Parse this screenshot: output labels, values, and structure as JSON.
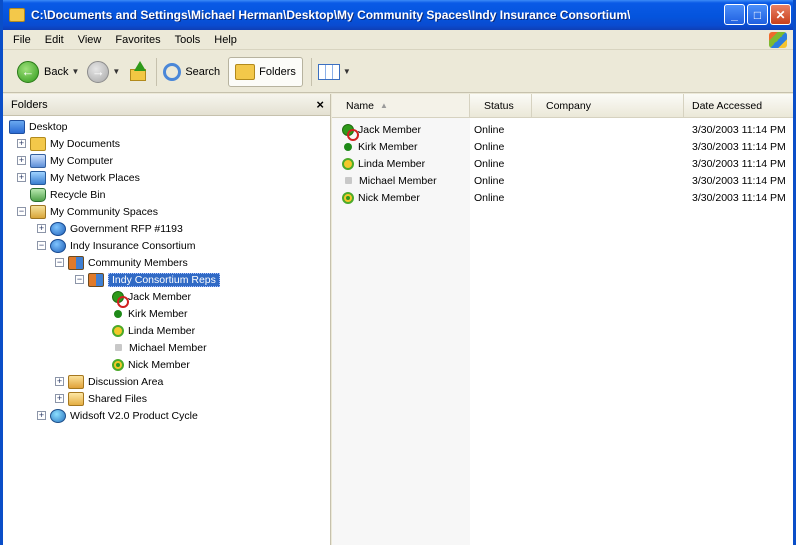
{
  "window": {
    "title": "C:\\Documents and Settings\\Michael Herman\\Desktop\\My Community Spaces\\Indy Insurance Consortium\\",
    "minimize": "_",
    "maximize": "□",
    "close": "✕"
  },
  "menu": [
    "File",
    "Edit",
    "View",
    "Favorites",
    "Tools",
    "Help"
  ],
  "toolbar": {
    "back": "Back",
    "search": "Search",
    "folders": "Folders"
  },
  "folders_pane": {
    "title": "Folders",
    "close": "×",
    "tree": {
      "desktop": "Desktop",
      "my_documents": "My Documents",
      "my_computer": "My Computer",
      "network": "My Network Places",
      "recycle": "Recycle Bin",
      "community_spaces": "My Community Spaces",
      "govt": "Government RFP #1193",
      "indy": "Indy Insurance Consortium",
      "community_members": "Community Members",
      "indy_reps": "Indy Consortium Reps",
      "members": [
        "Jack Member",
        "Kirk Member",
        "Linda Member",
        "Michael Member",
        "Nick Member"
      ],
      "discussion": "Discussion Area",
      "shared_files": "Shared Files",
      "widsoft": "Widsoft V2.0 Product Cycle"
    }
  },
  "list": {
    "columns": {
      "name": "Name",
      "status": "Status",
      "company": "Company",
      "date": "Date Accessed"
    },
    "rows": [
      {
        "name": "Jack Member",
        "status": "Online",
        "company": "",
        "date": "3/30/2003 11:14 PM",
        "icon": "online-busy-icon"
      },
      {
        "name": "Kirk Member",
        "status": "Online",
        "company": "",
        "date": "3/30/2003 11:14 PM",
        "icon": "online-dot-icon"
      },
      {
        "name": "Linda Member",
        "status": "Online",
        "company": "",
        "date": "3/30/2003 11:14 PM",
        "icon": "online-away-icon"
      },
      {
        "name": "Michael Member",
        "status": "Online",
        "company": "",
        "date": "3/30/2003 11:14 PM",
        "icon": "offline-square-icon"
      },
      {
        "name": "Nick Member",
        "status": "Online",
        "company": "",
        "date": "3/30/2003 11:14 PM",
        "icon": "online-idle-icon"
      }
    ]
  }
}
